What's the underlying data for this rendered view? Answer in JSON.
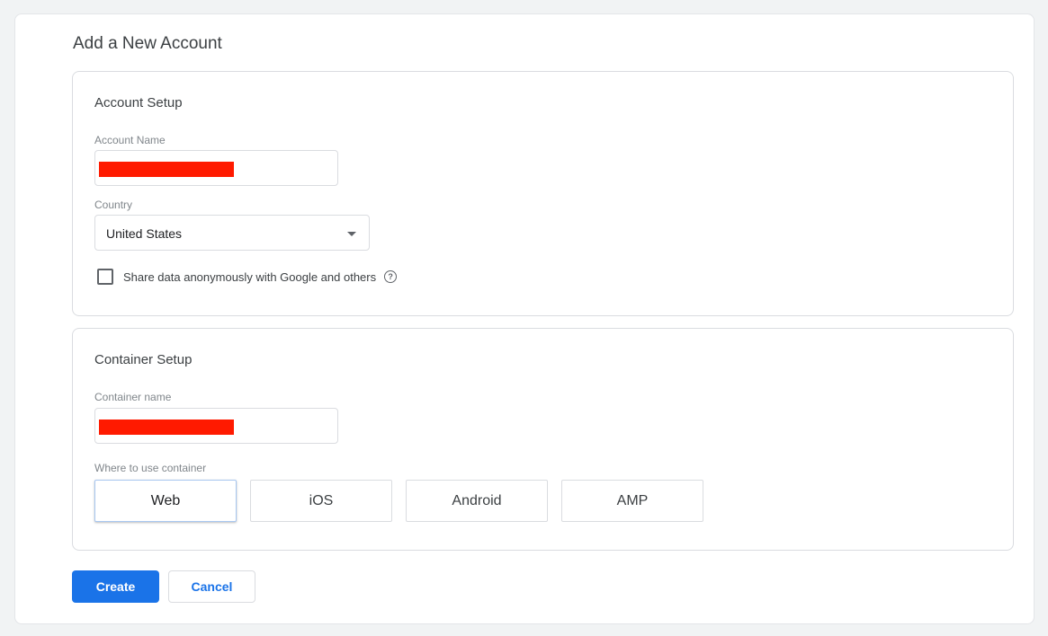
{
  "page": {
    "title": "Add a New Account"
  },
  "account_setup": {
    "title": "Account Setup",
    "account_name_label": "Account Name",
    "account_name_value": "",
    "country_label": "Country",
    "country_value": "United States",
    "share_data_label": "Share data anonymously with Google and others",
    "share_data_checked": false,
    "help_icon": "help-circle-icon"
  },
  "container_setup": {
    "title": "Container Setup",
    "container_name_label": "Container name",
    "container_name_value": "",
    "where_label": "Where to use container",
    "platforms": [
      {
        "label": "Web",
        "selected": true
      },
      {
        "label": "iOS",
        "selected": false
      },
      {
        "label": "Android",
        "selected": false
      },
      {
        "label": "AMP",
        "selected": false
      }
    ]
  },
  "actions": {
    "create_label": "Create",
    "cancel_label": "Cancel"
  },
  "colors": {
    "primary": "#1a73e8",
    "redaction": "#ff1a00",
    "background": "#f1f3f4"
  }
}
